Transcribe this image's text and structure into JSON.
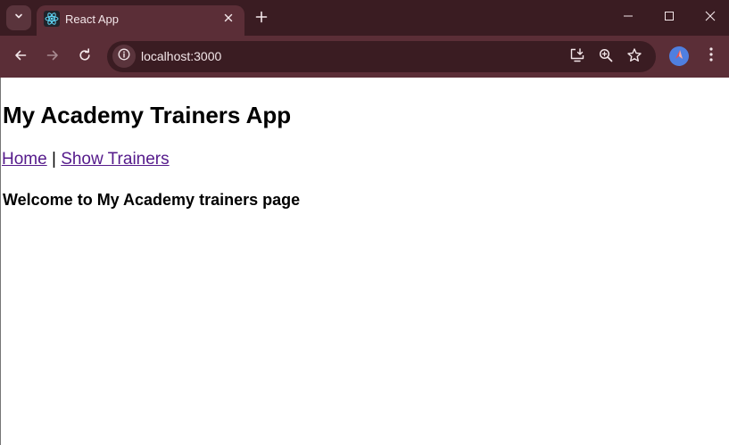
{
  "browser": {
    "tab": {
      "title": "React App",
      "favicon": "react-logo-icon"
    },
    "omnibox": {
      "url": "localhost:3000"
    },
    "colors": {
      "titlebar": "#3a1c22",
      "toolbar": "#5b2e37",
      "profile": "#4f7fe0"
    }
  },
  "page": {
    "title": "My Academy Trainers App",
    "nav": {
      "home_label": "Home",
      "separator": "|",
      "trainers_label": "Show Trainers"
    },
    "welcome": "Welcome to My Academy trainers page",
    "colors": {
      "visited_link": "#551a8b"
    }
  }
}
